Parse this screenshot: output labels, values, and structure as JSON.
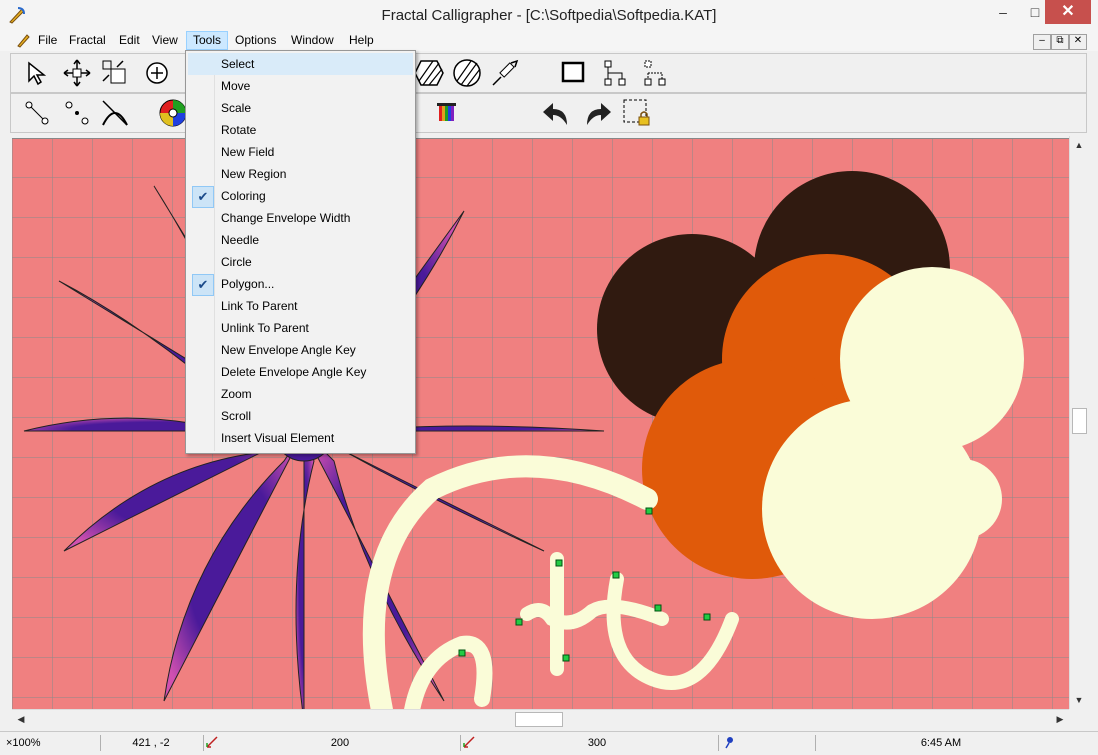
{
  "window": {
    "title": "Fractal Calligrapher - [C:\\Softpedia\\Softpedia.KAT]",
    "minimize_glyph": "–",
    "maximize_glyph": "□",
    "close_glyph": "✕"
  },
  "menu": {
    "items": [
      {
        "label": "File"
      },
      {
        "label": "Fractal"
      },
      {
        "label": "Edit"
      },
      {
        "label": "View"
      },
      {
        "label": "Tools"
      },
      {
        "label": "Options"
      },
      {
        "label": "Window"
      },
      {
        "label": "Help"
      }
    ],
    "mdi_minimize": "–",
    "mdi_restore": "⧉",
    "mdi_close": "✕"
  },
  "tools_menu": {
    "items": [
      {
        "label": "Select",
        "checked": false
      },
      {
        "label": "Move",
        "checked": false
      },
      {
        "label": "Scale",
        "checked": false
      },
      {
        "label": "Rotate",
        "checked": false
      },
      {
        "label": "New Field",
        "checked": false
      },
      {
        "label": "New Region",
        "checked": false
      },
      {
        "label": "Coloring",
        "checked": true
      },
      {
        "label": "Change Envelope Width",
        "checked": false
      },
      {
        "label": "Needle",
        "checked": false
      },
      {
        "label": "Circle",
        "checked": false
      },
      {
        "label": "Polygon...",
        "checked": true
      },
      {
        "label": "Link To Parent",
        "checked": false
      },
      {
        "label": "Unlink To Parent",
        "checked": false
      },
      {
        "label": "New Envelope Angle Key",
        "checked": false
      },
      {
        "label": "Delete Envelope Angle Key",
        "checked": false
      },
      {
        "label": "Zoom",
        "checked": false
      },
      {
        "label": "Scroll",
        "checked": false
      },
      {
        "label": "Insert Visual Element",
        "checked": false
      }
    ],
    "check_glyph": "✔"
  },
  "statusbar": {
    "zoom": "×100%",
    "coords": "421 , -2",
    "value1": "200",
    "value2": "300",
    "time": "6:45 AM"
  },
  "colors": {
    "canvas_bg": "#f08080",
    "grid": "#8a8a8a",
    "purple": "#4a1a9a",
    "dark_brown": "#301a10",
    "orange": "#e05a0a",
    "cream": "#fafcd8",
    "control_point": "#22cc44"
  }
}
